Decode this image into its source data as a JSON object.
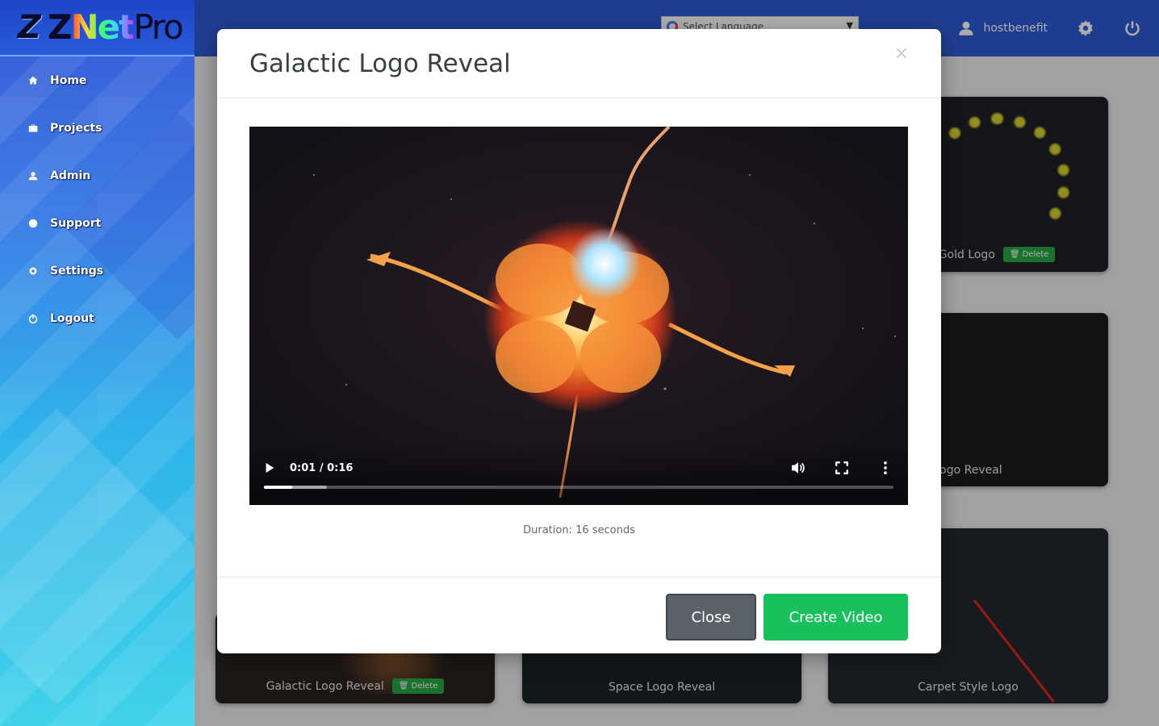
{
  "brand": {
    "mark": "Z",
    "text_1": "Z",
    "text_2": "Net",
    "text_3": "Pro"
  },
  "sidebar": {
    "items": [
      {
        "label": "Home",
        "icon": "home-icon"
      },
      {
        "label": "Projects",
        "icon": "briefcase-icon"
      },
      {
        "label": "Admin",
        "icon": "user-icon"
      },
      {
        "label": "Support",
        "icon": "help-icon"
      },
      {
        "label": "Settings",
        "icon": "gear-icon"
      },
      {
        "label": "Logout",
        "icon": "power-icon"
      }
    ]
  },
  "topbar": {
    "translate_label": "Select Language",
    "username": "hostbenefit"
  },
  "background_cards": [
    {
      "label": "Liquid Gold Logo",
      "badge": "Delete"
    },
    {
      "label": "Cube Logo Reveal"
    },
    {
      "label": "Galactic Logo Reveal",
      "badge": "Delete"
    },
    {
      "label": "Space Logo Reveal"
    },
    {
      "label": "Carpet Style Logo"
    }
  ],
  "modal": {
    "title": "Galactic Logo Reveal",
    "close_symbol": "×",
    "video": {
      "current_time": "0:01",
      "total_time": "0:16",
      "time_display": "0:01 / 0:16",
      "played_fraction": 0.045,
      "buffered_fraction": 0.1
    },
    "duration_text": "Duration: 16 seconds",
    "close_button": "Close",
    "create_button": "Create Video"
  },
  "colors": {
    "topbar": "#2f5bd4",
    "create_button": "#19c15d",
    "close_button": "#5a6268",
    "badge": "#28a745"
  }
}
